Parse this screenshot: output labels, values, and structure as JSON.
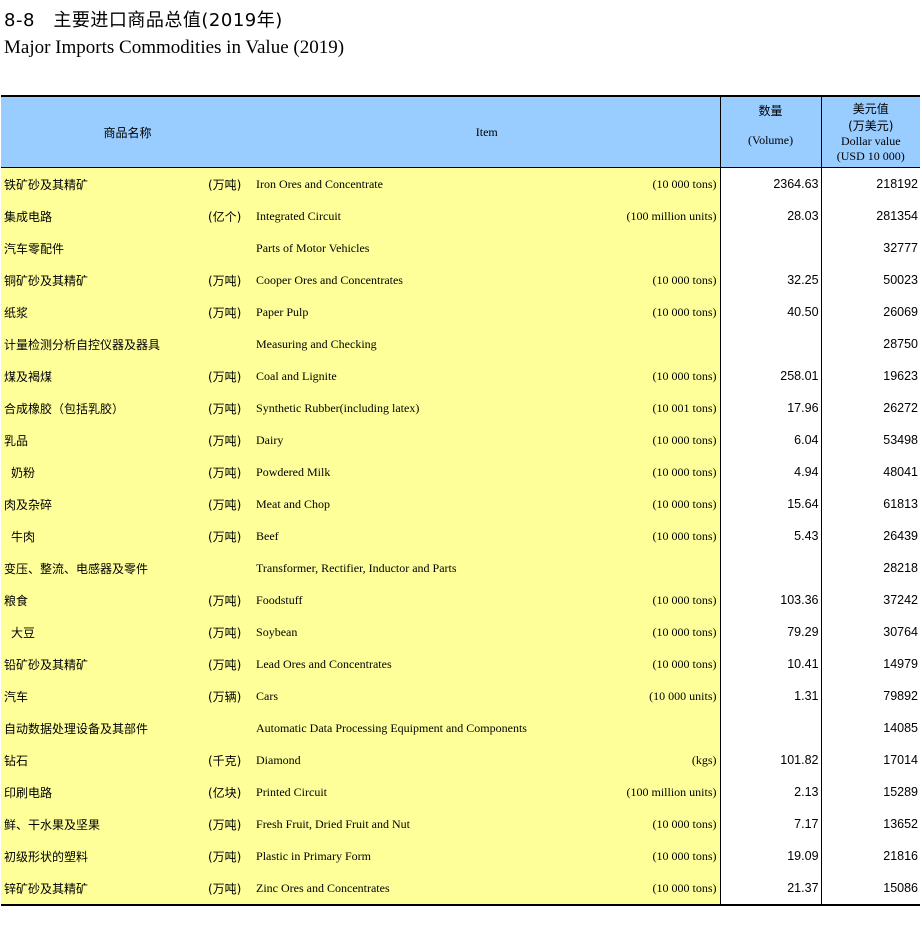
{
  "title_cn": "8-8　主要进口商品总值(2019年)",
  "title_en": "Major Imports Commodities in Value (2019)",
  "headers": {
    "name_cn": "商品名称",
    "item": "Item",
    "volume_cn": "数量",
    "volume_en": "(Volume)",
    "usd_cn": "美元值",
    "usd_unit_cn": "(万美元)",
    "usd_en": "Dollar value",
    "usd_unit_en": "(USD 10 000)"
  },
  "rows": [
    {
      "name_cn": "铁矿砂及其精矿",
      "unit_cn": "(万吨)",
      "name_en": "Iron Ores and Concentrate",
      "unit_en": "(10 000 tons)",
      "volume": "2364.63",
      "usd": "218192",
      "sub": false
    },
    {
      "name_cn": "集成电路",
      "unit_cn": "(亿个)",
      "name_en": "Integrated Circuit",
      "unit_en": "(100 million units)",
      "volume": "28.03",
      "usd": "281354",
      "sub": false
    },
    {
      "name_cn": "汽车零配件",
      "unit_cn": "",
      "name_en": "Parts of Motor Vehicles",
      "unit_en": "",
      "volume": "",
      "usd": "32777",
      "sub": false
    },
    {
      "name_cn": "铜矿砂及其精矿",
      "unit_cn": "(万吨)",
      "name_en": "Cooper Ores and Concentrates",
      "unit_en": "(10 000 tons)",
      "volume": "32.25",
      "usd": "50023",
      "sub": false
    },
    {
      "name_cn": "纸浆",
      "unit_cn": "(万吨)",
      "name_en": "Paper Pulp",
      "unit_en": "(10 000 tons)",
      "volume": "40.50",
      "usd": "26069",
      "sub": false
    },
    {
      "name_cn": "计量检测分析自控仪器及器具",
      "unit_cn": "",
      "name_en": "Measuring and Checking",
      "unit_en": "",
      "volume": "",
      "usd": "28750",
      "sub": false
    },
    {
      "name_cn": "煤及褐煤",
      "unit_cn": "(万吨)",
      "name_en": "Coal and Lignite",
      "unit_en": "(10 000 tons)",
      "volume": "258.01",
      "usd": "19623",
      "sub": false
    },
    {
      "name_cn": "合成橡胶（包括乳胶）",
      "unit_cn": "(万吨)",
      "name_en": "Synthetic Rubber(including latex)",
      "unit_en": "(10 001 tons)",
      "volume": "17.96",
      "usd": "26272",
      "sub": false
    },
    {
      "name_cn": "乳品",
      "unit_cn": "(万吨)",
      "name_en": "Dairy",
      "unit_en": "(10 000 tons)",
      "volume": "6.04",
      "usd": "53498",
      "sub": false
    },
    {
      "name_cn": "奶粉",
      "unit_cn": "(万吨)",
      "name_en": "Powdered Milk",
      "unit_en": "(10 000 tons)",
      "volume": "4.94",
      "usd": "48041",
      "sub": true
    },
    {
      "name_cn": "肉及杂碎",
      "unit_cn": "(万吨)",
      "name_en": "Meat and Chop",
      "unit_en": "(10 000 tons)",
      "volume": "15.64",
      "usd": "61813",
      "sub": false
    },
    {
      "name_cn": "牛肉",
      "unit_cn": "(万吨)",
      "name_en": "Beef",
      "unit_en": "(10 000 tons)",
      "volume": "5.43",
      "usd": "26439",
      "sub": true
    },
    {
      "name_cn": "变压、整流、电感器及零件",
      "unit_cn": "",
      "name_en": "Transformer, Rectifier, Inductor and Parts",
      "unit_en": "",
      "volume": "",
      "usd": "28218",
      "sub": false
    },
    {
      "name_cn": "粮食",
      "unit_cn": "(万吨)",
      "name_en": "Foodstuff",
      "unit_en": "(10 000 tons)",
      "volume": "103.36",
      "usd": "37242",
      "sub": false
    },
    {
      "name_cn": "大豆",
      "unit_cn": "(万吨)",
      "name_en": "Soybean",
      "unit_en": "(10 000 tons)",
      "volume": "79.29",
      "usd": "30764",
      "sub": true
    },
    {
      "name_cn": "铅矿砂及其精矿",
      "unit_cn": "(万吨)",
      "name_en": "Lead Ores and Concentrates",
      "unit_en": "(10 000 tons)",
      "volume": "10.41",
      "usd": "14979",
      "sub": false
    },
    {
      "name_cn": "汽车",
      "unit_cn": "(万辆)",
      "name_en": "Cars",
      "unit_en": "(10 000 units)",
      "volume": "1.31",
      "usd": "79892",
      "sub": false
    },
    {
      "name_cn": "自动数据处理设备及其部件",
      "unit_cn": "",
      "name_en": "Automatic Data Processing Equipment and Components",
      "unit_en": "",
      "volume": "",
      "usd": "14085",
      "sub": false
    },
    {
      "name_cn": "钻石",
      "unit_cn": "(千克)",
      "name_en": "Diamond",
      "unit_en": "(kgs)",
      "volume": "101.82",
      "usd": "17014",
      "sub": false
    },
    {
      "name_cn": "印刷电路",
      "unit_cn": "(亿块)",
      "name_en": "Printed Circuit",
      "unit_en": "(100 million units)",
      "volume": "2.13",
      "usd": "15289",
      "sub": false
    },
    {
      "name_cn": "鲜、干水果及坚果",
      "unit_cn": "(万吨)",
      "name_en": "Fresh Fruit, Dried Fruit and Nut",
      "unit_en": "(10 000 tons)",
      "volume": "7.17",
      "usd": "13652",
      "sub": false
    },
    {
      "name_cn": "初级形状的塑料",
      "unit_cn": "(万吨)",
      "name_en": "Plastic in Primary Form",
      "unit_en": "(10 000 tons)",
      "volume": "19.09",
      "usd": "21816",
      "sub": false
    },
    {
      "name_cn": "锌矿砂及其精矿",
      "unit_cn": "(万吨)",
      "name_en": "Zinc Ores and Concentrates",
      "unit_en": "(10 000 tons)",
      "volume": "21.37",
      "usd": "15086",
      "sub": false
    }
  ]
}
